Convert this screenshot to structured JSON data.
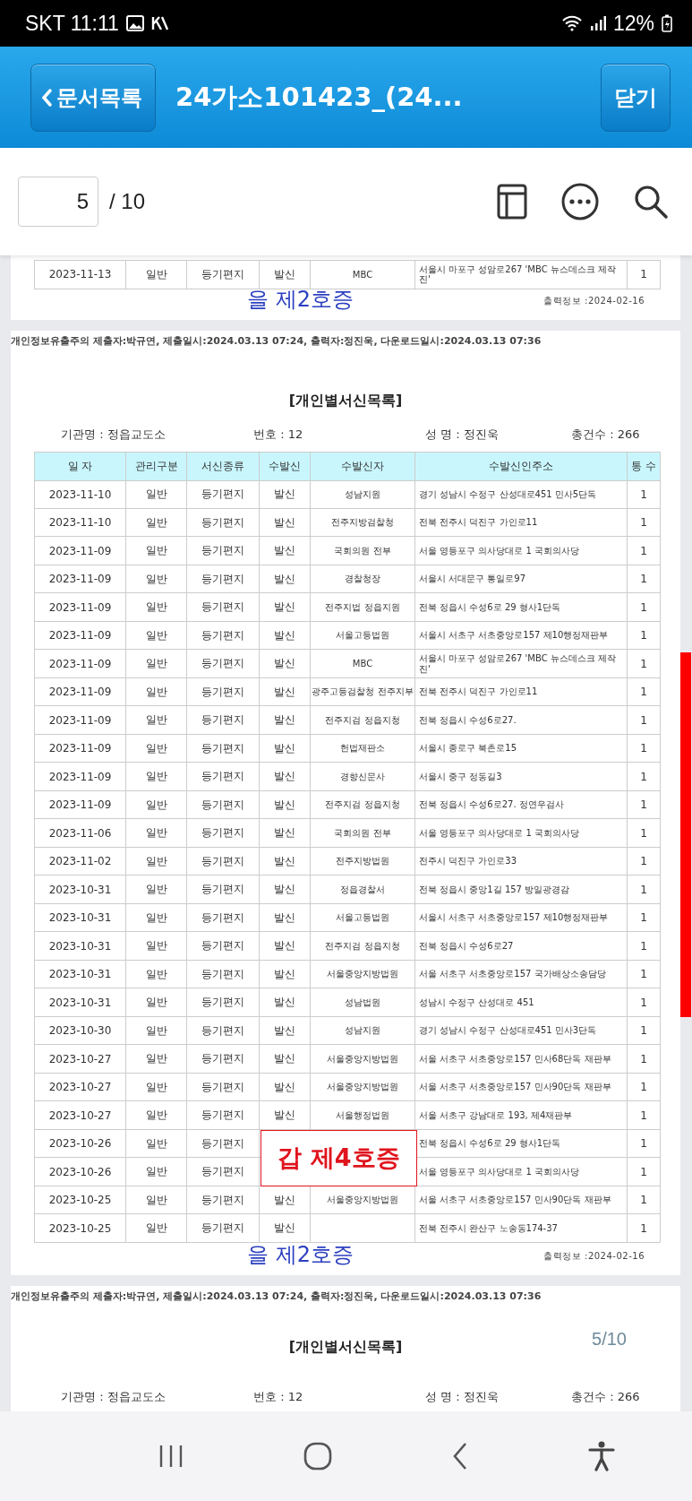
{
  "status_bar": {
    "carrier_time": "SKT 11:11",
    "battery": "12%"
  },
  "app_bar": {
    "back": "문서목록",
    "title": "24가소101423_(24...",
    "close": "닫기"
  },
  "toolbar": {
    "page_value": "5",
    "page_total": "/ 10"
  },
  "columns": [
    "일 자",
    "관리구분",
    "서신종류",
    "수발신",
    "수발신자",
    "수발신인주소",
    "통 수"
  ],
  "pages": [
    {
      "kind": "fragment",
      "output_info": "출력정보 :2024-02-16",
      "stamps": [
        {
          "kind": "plain",
          "text": "을 제2호증",
          "color": "#2b3fc0"
        }
      ],
      "rows": [
        {
          "date": "2023-11-13",
          "category": "일반",
          "type": "등기편지",
          "direction": "발신",
          "sender": "MBC",
          "address": "서울시 마포구 성암로267 'MBC 뉴스데스크 제작진'",
          "count": "1"
        }
      ]
    },
    {
      "kind": "full",
      "notice": "개인정보유출주의 제출자:박규연, 제출일시:2024.03.13 07:24, 출력자:정진욱, 다운로드일시:2024.03.13 07:36",
      "title": "[개인별서신목록]",
      "info": [
        "기관명 : 정읍교도소",
        "번호 : 12",
        "성 명 : 정진욱",
        "총건수 : 266"
      ],
      "output_info": "출력정보 :2024-02-16",
      "stamps": [
        {
          "kind": "boxed",
          "text": "갑 제4호증",
          "color": "#e0141e"
        },
        {
          "kind": "plain",
          "text": "을 제2호증",
          "color": "#2b3fc0"
        }
      ],
      "rows": [
        {
          "date": "2023-11-10",
          "category": "일반",
          "type": "등기편지",
          "direction": "발신",
          "sender": "성남지원",
          "address": "경기 성남시 수정구 산성대로451 민사5단독",
          "count": "1"
        },
        {
          "date": "2023-11-10",
          "category": "일반",
          "type": "등기편지",
          "direction": "발신",
          "sender": "전주지방검찰청",
          "address": "전북 전주시 덕진구 가인로11",
          "count": "1"
        },
        {
          "date": "2023-11-09",
          "category": "일반",
          "type": "등기편지",
          "direction": "발신",
          "sender": "국회의원 전부",
          "address": "서울 영등포구 의사당대로 1 국회의사당",
          "count": "1"
        },
        {
          "date": "2023-11-09",
          "category": "일반",
          "type": "등기편지",
          "direction": "발신",
          "sender": "경찰청장",
          "address": "서울시 서대문구 통일로97",
          "count": "1"
        },
        {
          "date": "2023-11-09",
          "category": "일반",
          "type": "등기편지",
          "direction": "발신",
          "sender": "전주지법 정읍지원",
          "address": "전북 정읍시 수성6로 29 형사1단독",
          "count": "1"
        },
        {
          "date": "2023-11-09",
          "category": "일반",
          "type": "등기편지",
          "direction": "발신",
          "sender": "서울고등법원",
          "address": "서울시 서초구 서초중앙로157 제10행정재판부",
          "count": "1"
        },
        {
          "date": "2023-11-09",
          "category": "일반",
          "type": "등기편지",
          "direction": "발신",
          "sender": "MBC",
          "address": "서울시 마포구 성암로267 'MBC 뉴스데스크 제작진'",
          "count": "1"
        },
        {
          "date": "2023-11-09",
          "category": "일반",
          "type": "등기편지",
          "direction": "발신",
          "sender": "광주고등검찰청 전주지부",
          "address": "전북 전주시 덕진구 가인로11",
          "count": "1"
        },
        {
          "date": "2023-11-09",
          "category": "일반",
          "type": "등기편지",
          "direction": "발신",
          "sender": "전주지검 정읍지청",
          "address": "전북 정읍시 수성6로27.",
          "count": "1"
        },
        {
          "date": "2023-11-09",
          "category": "일반",
          "type": "등기편지",
          "direction": "발신",
          "sender": "헌법재판소",
          "address": "서울시 종로구 북촌로15",
          "count": "1"
        },
        {
          "date": "2023-11-09",
          "category": "일반",
          "type": "등기편지",
          "direction": "발신",
          "sender": "경향신문사",
          "address": "서울시 중구 정동길3",
          "count": "1"
        },
        {
          "date": "2023-11-09",
          "category": "일반",
          "type": "등기편지",
          "direction": "발신",
          "sender": "전주지검 정읍지청",
          "address": "전북 정읍시 수성6로27. 정연우검사",
          "count": "1"
        },
        {
          "date": "2023-11-06",
          "category": "일반",
          "type": "등기편지",
          "direction": "발신",
          "sender": "국회의원 전부",
          "address": "서울 영등포구 의사당대로 1 국회의사당",
          "count": "1"
        },
        {
          "date": "2023-11-02",
          "category": "일반",
          "type": "등기편지",
          "direction": "발신",
          "sender": "전주지방법원",
          "address": "전주시 덕진구 가인로33",
          "count": "1"
        },
        {
          "date": "2023-10-31",
          "category": "일반",
          "type": "등기편지",
          "direction": "발신",
          "sender": "정읍경찰서",
          "address": "전북 정읍시 중앙1길 157 방일광경감",
          "count": "1"
        },
        {
          "date": "2023-10-31",
          "category": "일반",
          "type": "등기편지",
          "direction": "발신",
          "sender": "서울고등법원",
          "address": "서울시 서초구 서초중앙로157 제10행정재판부",
          "count": "1"
        },
        {
          "date": "2023-10-31",
          "category": "일반",
          "type": "등기편지",
          "direction": "발신",
          "sender": "전주지검 정읍지청",
          "address": "전북 정읍시 수성6로27",
          "count": "1"
        },
        {
          "date": "2023-10-31",
          "category": "일반",
          "type": "등기편지",
          "direction": "발신",
          "sender": "서울중앙지방법원",
          "address": "서울 서초구 서초중앙로157 국가배상소송담당",
          "count": "1"
        },
        {
          "date": "2023-10-31",
          "category": "일반",
          "type": "등기편지",
          "direction": "발신",
          "sender": "성남법원",
          "address": "성남시 수정구 산성대로 451",
          "count": "1"
        },
        {
          "date": "2023-10-30",
          "category": "일반",
          "type": "등기편지",
          "direction": "발신",
          "sender": "성남지원",
          "address": "경기 성남시 수정구 산성대로451 민사3단독",
          "count": "1"
        },
        {
          "date": "2023-10-27",
          "category": "일반",
          "type": "등기편지",
          "direction": "발신",
          "sender": "서울중앙지방법원",
          "address": "서울 서초구 서초중앙로157 민사68단독 재판부",
          "count": "1"
        },
        {
          "date": "2023-10-27",
          "category": "일반",
          "type": "등기편지",
          "direction": "발신",
          "sender": "서울중앙지방법원",
          "address": "서울 서초구 서초중앙로157 민사90단독 재판부",
          "count": "1"
        },
        {
          "date": "2023-10-27",
          "category": "일반",
          "type": "등기편지",
          "direction": "발신",
          "sender": "서울행정법원",
          "address": "서울 서초구 강남대로 193, 제4재판부",
          "count": "1"
        },
        {
          "date": "2023-10-26",
          "category": "일반",
          "type": "등기편지",
          "address": "전북 정읍시 수성6로 29 형사1단독",
          "count": "1"
        },
        {
          "date": "2023-10-26",
          "category": "일반",
          "type": "등기편지",
          "address": "서울 영등포구 의사당대로 1 국회의사당",
          "count": "1"
        },
        {
          "date": "2023-10-25",
          "category": "일반",
          "type": "등기편지",
          "direction": "발신",
          "sender": "서울중앙지방법원",
          "address": "서울 서초구 서초중앙로157 민사90단독 재판부",
          "count": "1"
        },
        {
          "date": "2023-10-25",
          "category": "일반",
          "type": "등기편지",
          "direction": "발신",
          "address": "전북 전주시 완산구 노송동174-37",
          "count": "1"
        }
      ]
    },
    {
      "kind": "cut",
      "notice": "개인정보유출주의 제출자:박규연, 제출일시:2024.03.13 07:24, 출력자:정진욱, 다운로드일시:2024.03.13 07:36",
      "title": "[개인별서신목록]",
      "page_label": "5/10",
      "info": [
        "기관명 : 정읍교도소",
        "번호 : 12",
        "성 명 : 정진욱",
        "총건수 : 266"
      ]
    }
  ]
}
